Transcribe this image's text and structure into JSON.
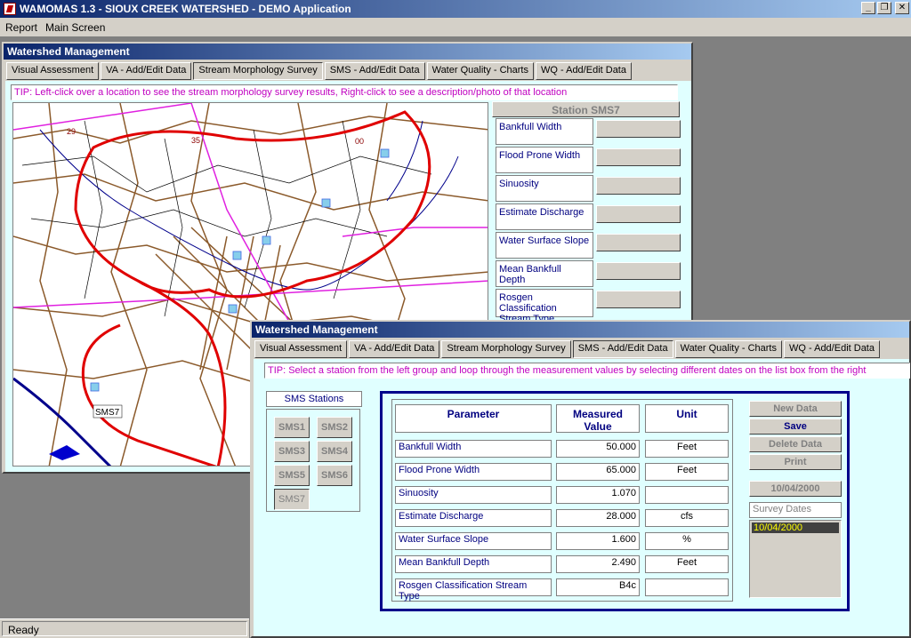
{
  "app": {
    "title": "WAMOMAS 1.3 - SIOUX CREEK WATERSHED - DEMO Application",
    "menu": [
      "Report",
      "Main Screen"
    ],
    "status": "Ready"
  },
  "tabs": [
    {
      "label": "Visual Assessment"
    },
    {
      "label": "VA - Add/Edit Data"
    },
    {
      "label": "Stream Morphology Survey"
    },
    {
      "label": "SMS - Add/Edit Data"
    },
    {
      "label": "Water Quality - Charts"
    },
    {
      "label": "WQ - Add/Edit Data"
    }
  ],
  "window1": {
    "title": "Watershed Management",
    "tip": "TIP: Left-click over a location to see  the stream morphology survey results, Right-click to see a description/photo of that location",
    "station_header": "Station SMS7",
    "map_label": "SMS7",
    "map_text": [
      "29",
      "35",
      "00"
    ],
    "fields": [
      "Bankfull Width",
      "Flood Prone Width",
      "Sinuosity",
      "Estimate Discharge",
      "Water Surface Slope",
      "Mean Bankfull Depth",
      "Rosgen Classification Stream Type"
    ]
  },
  "window2": {
    "title": "Watershed Management",
    "tip": "TIP: Select a station from the left group and loop through the measurement values by selecting different dates on the list box from the right",
    "stations_label": "SMS Stations",
    "stations": [
      "SMS1",
      "SMS2",
      "SMS3",
      "SMS4",
      "SMS5",
      "SMS6",
      "SMS7"
    ],
    "headers": {
      "parameter": "Parameter",
      "value": "Measured Value",
      "unit": "Unit"
    },
    "rows": [
      {
        "param": "Bankfull Width",
        "value": "50.000",
        "unit": "Feet"
      },
      {
        "param": "Flood Prone Width",
        "value": "65.000",
        "unit": "Feet"
      },
      {
        "param": "Sinuosity",
        "value": "1.070",
        "unit": ""
      },
      {
        "param": "Estimate Discharge",
        "value": "28.000",
        "unit": "cfs"
      },
      {
        "param": "Water Surface Slope",
        "value": "1.600",
        "unit": "%"
      },
      {
        "param": "Mean Bankfull Depth",
        "value": "2.490",
        "unit": "Feet"
      },
      {
        "param": "Rosgen Classification Stream Type",
        "value": "B4c",
        "unit": ""
      }
    ],
    "buttons": {
      "new": "New Data",
      "save": "Save",
      "delete": "Delete Data",
      "print": "Print"
    },
    "date_button": "10/04/2000",
    "dates_label": "Survey Dates",
    "dates": [
      "10/04/2000"
    ]
  }
}
